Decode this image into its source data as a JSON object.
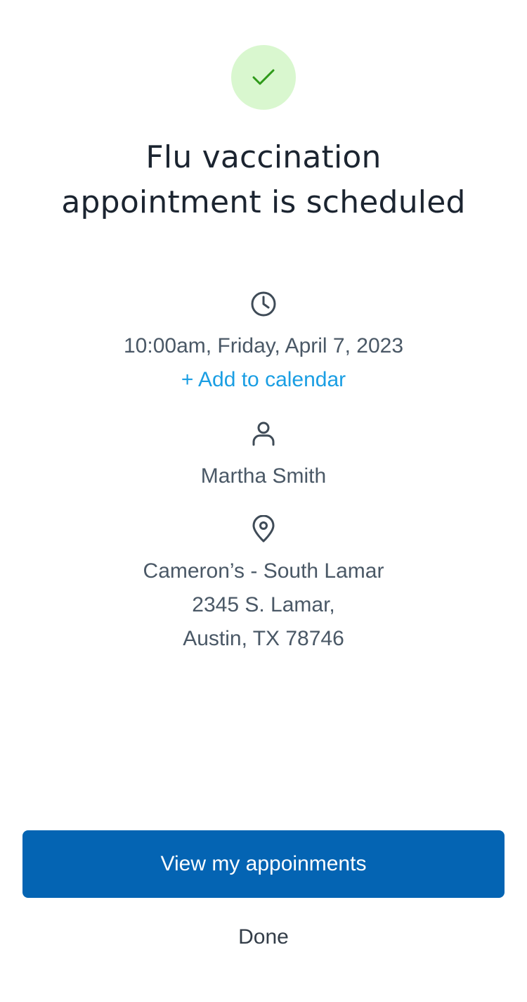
{
  "header": {
    "icon": "checkmark-icon",
    "title_line1": "Flu vaccination",
    "title_line2": "appointment is scheduled"
  },
  "details": {
    "time_icon": "clock-icon",
    "datetime": "10:00am, Friday, April 7, 2023",
    "add_to_calendar": "+ Add to calendar",
    "person_icon": "person-icon",
    "patient_name": "Martha Smith",
    "location_icon": "location-pin-icon",
    "location_name": "Cameron’s - South Lamar",
    "address_line1": "2345 S. Lamar,",
    "address_line2": "Austin, TX 78746"
  },
  "actions": {
    "primary_label": "View my appoinments",
    "secondary_label": "Done"
  },
  "colors": {
    "success_bg": "#d9f7cf",
    "success_check": "#2f9a1a",
    "primary": "#0464b3",
    "link": "#1a9ee3",
    "title_text": "#1b2430",
    "body_text": "#4a5866"
  }
}
